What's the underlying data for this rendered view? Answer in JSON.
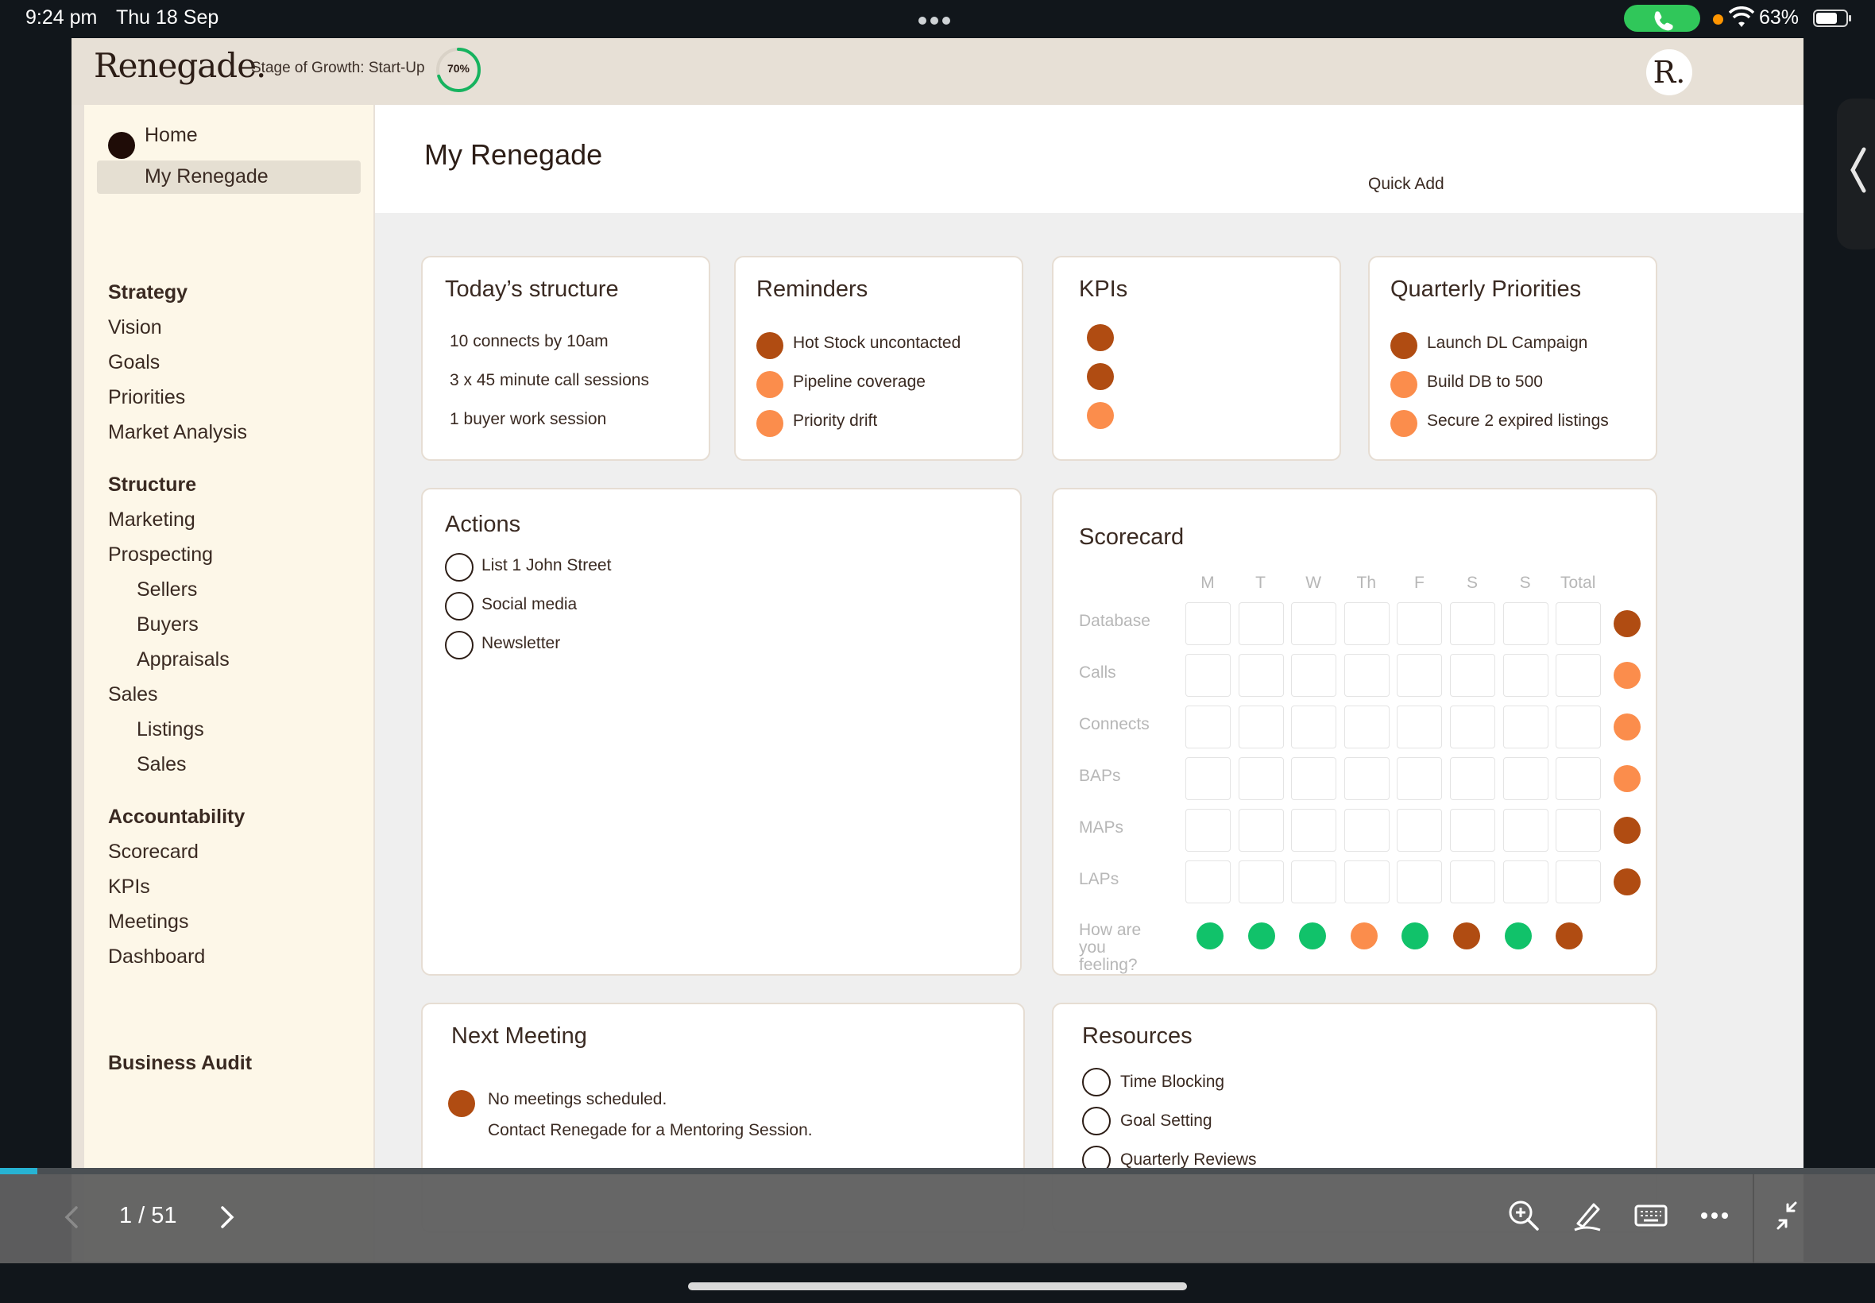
{
  "status_bar": {
    "time": "9:24 pm",
    "date": "Thu 18 Sep",
    "battery": "63%"
  },
  "topbar": {
    "logo": "Renegade.",
    "stage_label": "Stage of Growth: Start-Up",
    "progress_text": "70%",
    "progress_value": 0.7,
    "avatar_initial": "R."
  },
  "sidebar": {
    "home": "Home",
    "active": "My Renegade",
    "strategy": {
      "heading": "Strategy",
      "items": [
        "Vision",
        "Goals",
        "Priorities",
        "Market Analysis"
      ]
    },
    "structure": {
      "heading": "Structure",
      "marketing": "Marketing",
      "prospecting": "Prospecting",
      "prospecting_sub": [
        "Sellers",
        "Buyers",
        "Appraisals"
      ],
      "sales": "Sales",
      "sales_sub": [
        "Listings",
        "Sales"
      ]
    },
    "accountability": {
      "heading": "Accountability",
      "items": [
        "Scorecard",
        "KPIs",
        "Meetings",
        "Dashboard"
      ]
    },
    "business_audit": "Business Audit"
  },
  "main": {
    "title": "My Renegade",
    "quick_add": "Quick Add"
  },
  "todays_structure": {
    "title": "Today’s structure",
    "items": [
      "10 connects by 10am",
      "3 x 45 minute call sessions",
      "1 buyer work session"
    ]
  },
  "reminders": {
    "title": "Reminders",
    "items": [
      {
        "label": "Hot Stock uncontacted",
        "color": "#b04c12"
      },
      {
        "label": "Pipeline coverage",
        "color": "#fb8d4c"
      },
      {
        "label": "Priority drift",
        "color": "#fb8d4c"
      }
    ]
  },
  "kpis": {
    "title": "KPIs",
    "colors": [
      "#b04c12",
      "#b04c12",
      "#fb8d4c"
    ]
  },
  "quarterly_priorities": {
    "title": "Quarterly Priorities",
    "items": [
      {
        "label": "Launch DL Campaign",
        "color": "#b04c12"
      },
      {
        "label": "Build DB to 500",
        "color": "#fb8d4c"
      },
      {
        "label": "Secure 2 expired listings",
        "color": "#fb8d4c"
      }
    ]
  },
  "actions": {
    "title": "Actions",
    "items": [
      "List 1 John Street",
      "Social media",
      "Newsletter"
    ]
  },
  "scorecard": {
    "title": "Scorecard",
    "columns": [
      "M",
      "T",
      "W",
      "Th",
      "F",
      "S",
      "S",
      "Total"
    ],
    "rows": [
      {
        "label": "Database",
        "status": "#b04c12"
      },
      {
        "label": "Calls",
        "status": "#fb8d4c"
      },
      {
        "label": "Connects",
        "status": "#fb8d4c"
      },
      {
        "label": "BAPs",
        "status": "#fb8d4c"
      },
      {
        "label": "MAPs",
        "status": "#b04c12"
      },
      {
        "label": "LAPs",
        "status": "#b04c12"
      }
    ],
    "feeling_label": "How are you feeling?",
    "feeling": [
      "#11c26a",
      "#11c26a",
      "#11c26a",
      "#fb8d4c",
      "#11c26a",
      "#b04c12",
      "#11c26a",
      "#b04c12"
    ]
  },
  "next_meeting": {
    "title": "Next Meeting",
    "line1": "No meetings scheduled.",
    "line2": "Contact Renegade for a Mentoring Session."
  },
  "resources": {
    "title": "Resources",
    "items": [
      "Time Blocking",
      "Goal Setting",
      "Quarterly Reviews"
    ]
  },
  "viewer": {
    "page_indicator": "1 / 51",
    "progress_fraction": 0.02
  }
}
